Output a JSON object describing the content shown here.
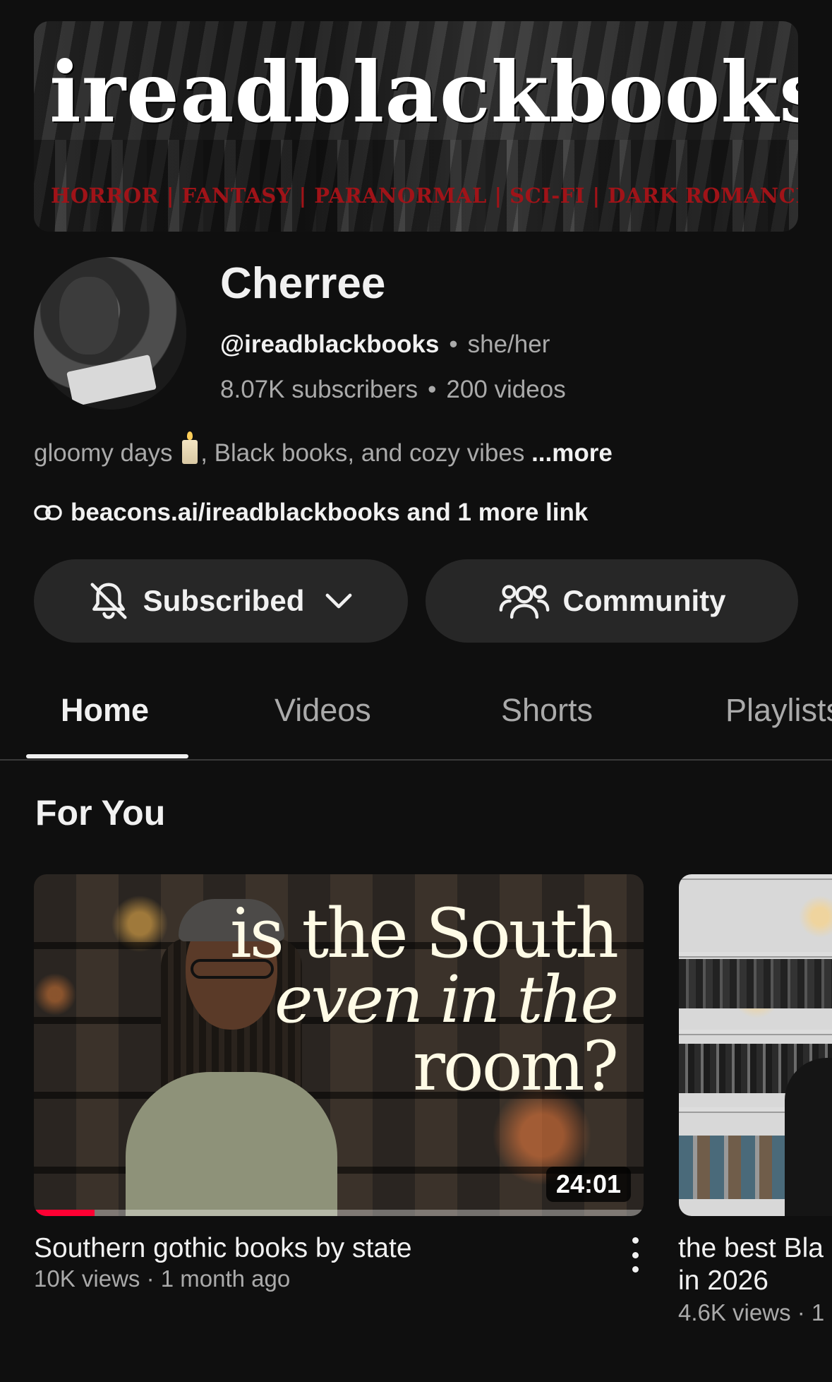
{
  "banner": {
    "title": "ireadblackbooks",
    "tagline": "HORROR | FANTASY | PARANORMAL | SCI-FI | DARK ROMANCE"
  },
  "channel": {
    "name": "Cherree",
    "handle": "@ireadblackbooks",
    "pronouns": "she/her",
    "subscribers": "8.07K subscribers",
    "videos": "200 videos",
    "description_a": "gloomy days ",
    "description_b": ", Black books, and cozy vibes ",
    "description_more": "...more",
    "link": "beacons.ai/ireadblackbooks and 1 more link"
  },
  "buttons": {
    "subscribed": "Subscribed",
    "community": "Community"
  },
  "tabs": [
    "Home",
    "Videos",
    "Shorts",
    "Playlists"
  ],
  "section": {
    "title": "For You"
  },
  "videos": [
    {
      "thumb_text_1": "is the South",
      "thumb_text_2": "even in the",
      "thumb_text_3": "room?",
      "duration": "24:01",
      "watched_fraction": 0.1,
      "title": "Southern gothic books by state",
      "meta": "10K views · 1 month ago"
    },
    {
      "title_line1": "the best Bla",
      "title_line2": "in 2026",
      "meta": "4.6K views · 1"
    }
  ],
  "colors": {
    "background": "#0f0f0f",
    "button_bg": "#272727",
    "secondary_text": "#aaaaaa",
    "progress": "#ff0033",
    "banner_tagline": "#a01318"
  },
  "icons": [
    "bell-off-icon",
    "chevron-down-icon",
    "community-icon",
    "link-icon",
    "more-vert-icon"
  ]
}
